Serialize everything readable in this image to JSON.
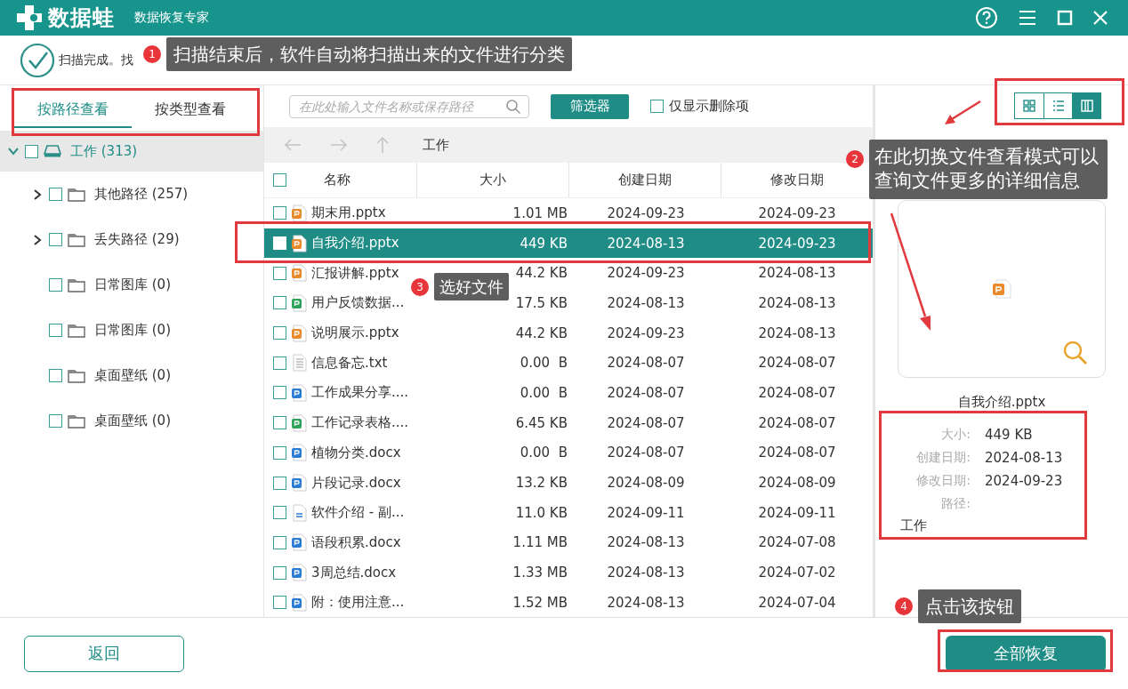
{
  "window": {
    "brand": "数据蛙",
    "subtitle": "数据恢复专家"
  },
  "status": {
    "text": "扫描完成。找"
  },
  "view_tabs": [
    {
      "label": "按路径查看",
      "selected": true
    },
    {
      "label": "按类型查看",
      "selected": false
    }
  ],
  "tree": [
    {
      "label": "工作 (313)",
      "kind": "drive",
      "expanded": true,
      "checked": false,
      "selected": true,
      "children": [
        {
          "label": "其他路径 (257)",
          "kind": "folder",
          "expandable": true,
          "checked": false,
          "selected": false
        },
        {
          "label": "丢失路径 (29)",
          "kind": "folder",
          "expandable": true,
          "checked": false,
          "selected": false
        },
        {
          "label": "日常图库 (0)",
          "kind": "folder",
          "expandable": false,
          "checked": false,
          "selected": false
        },
        {
          "label": "日常图库 (0)",
          "kind": "folder",
          "expandable": false,
          "checked": false,
          "selected": false
        },
        {
          "label": "桌面壁纸 (0)",
          "kind": "folder",
          "expandable": false,
          "checked": false,
          "selected": false
        },
        {
          "label": "桌面壁纸 (0)",
          "kind": "folder",
          "expandable": false,
          "checked": false,
          "selected": false
        }
      ]
    }
  ],
  "search": {
    "placeholder": "在此处输入文件名称或保存路径"
  },
  "filter_button": "筛选器",
  "deleted_only": {
    "label": "仅显示删除项",
    "checked": false
  },
  "view_modes": [
    {
      "kind": "grid",
      "selected": false
    },
    {
      "kind": "list",
      "selected": false
    },
    {
      "kind": "detail",
      "selected": true
    }
  ],
  "path": "工作",
  "table": {
    "columns": [
      "名称",
      "大小",
      "创建日期",
      "修改日期"
    ],
    "select_all_checked": false,
    "rows": [
      {
        "kind": "pptx",
        "name": "期末用.pptx",
        "size": "1.01 MB",
        "created": "2024-09-23",
        "modified": "2024-09-23",
        "checked": false,
        "selected": false
      },
      {
        "kind": "pptx",
        "name": "自我介绍.pptx",
        "size": "449 KB",
        "created": "2024-08-13",
        "modified": "2024-09-23",
        "checked": false,
        "selected": true
      },
      {
        "kind": "pptx",
        "name": "汇报讲解.pptx",
        "size": "44.2 KB",
        "created": "2024-09-23",
        "modified": "2024-08-13",
        "checked": false,
        "selected": false
      },
      {
        "kind": "xlsx",
        "name": "用户反馈数据...",
        "size": "17.5 KB",
        "created": "2024-08-13",
        "modified": "2024-08-13",
        "checked": false,
        "selected": false
      },
      {
        "kind": "pptx",
        "name": "说明展示.pptx",
        "size": "44.2 KB",
        "created": "2024-09-23",
        "modified": "2024-08-13",
        "checked": false,
        "selected": false
      },
      {
        "kind": "txt",
        "name": "信息备忘.txt",
        "size": "0.00  B",
        "created": "2024-08-07",
        "modified": "2024-08-07",
        "checked": false,
        "selected": false
      },
      {
        "kind": "docx",
        "name": "工作成果分享....",
        "size": "0.00  B",
        "created": "2024-08-07",
        "modified": "2024-08-07",
        "checked": false,
        "selected": false
      },
      {
        "kind": "xlsx",
        "name": "工作记录表格....",
        "size": "6.45 KB",
        "created": "2024-08-07",
        "modified": "2024-08-07",
        "checked": false,
        "selected": false
      },
      {
        "kind": "docx",
        "name": "植物分类.docx",
        "size": "0.00  B",
        "created": "2024-08-07",
        "modified": "2024-08-07",
        "checked": false,
        "selected": false
      },
      {
        "kind": "docx",
        "name": "片段记录.docx",
        "size": "13.2 KB",
        "created": "2024-08-09",
        "modified": "2024-08-09",
        "checked": false,
        "selected": false
      },
      {
        "kind": "doc",
        "name": "软件介绍 - 副...",
        "size": "11.0 KB",
        "created": "2024-09-11",
        "modified": "2024-09-11",
        "checked": false,
        "selected": false
      },
      {
        "kind": "docx",
        "name": "语段积累.docx",
        "size": "1.11 MB",
        "created": "2024-08-13",
        "modified": "2024-07-08",
        "checked": false,
        "selected": false
      },
      {
        "kind": "docx",
        "name": "3周总结.docx",
        "size": "1.33 MB",
        "created": "2024-08-13",
        "modified": "2024-07-02",
        "checked": false,
        "selected": false
      },
      {
        "kind": "docx",
        "name": "附：使用注意...",
        "size": "1.52 MB",
        "created": "2024-08-13",
        "modified": "2024-07-04",
        "checked": false,
        "selected": false
      }
    ]
  },
  "preview": {
    "kind": "pptx",
    "filename": "自我介绍.pptx",
    "details": [
      {
        "label": "大小:",
        "value": "449 KB"
      },
      {
        "label": "创建日期:",
        "value": "2024-08-13"
      },
      {
        "label": "修改日期:",
        "value": "2024-09-23"
      },
      {
        "label": "路径:"
      }
    ],
    "path_value": "工作"
  },
  "footer": {
    "back_button": "返回",
    "recover_button": "全部恢复"
  },
  "callouts": [
    {
      "number": "1",
      "text": "扫描结束后，软件自动将扫描出来的文件进行分类"
    },
    {
      "number": "2",
      "text": "在此切换文件查看模式可以查询文件更多的详细信息"
    },
    {
      "number": "3",
      "text": "选好文件"
    },
    {
      "number": "4",
      "text": "点击该按钮"
    }
  ]
}
